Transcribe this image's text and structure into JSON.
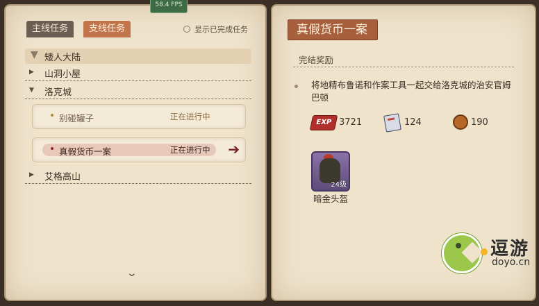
{
  "fps": "58.4 FPS",
  "left_page": {
    "tabs": {
      "main": "主线任务",
      "side": "支线任务"
    },
    "show_completed": "显示已完成任务",
    "groups": [
      {
        "label": "矮人大陆"
      },
      {
        "label": "山洞小屋"
      },
      {
        "label": "洛克城"
      },
      {
        "label": "艾格高山"
      }
    ],
    "quests": [
      {
        "name": "别碰罐子",
        "status": "正在进行中"
      },
      {
        "name": "真假货币一案",
        "status": "正在进行中"
      }
    ]
  },
  "right_page": {
    "title": "真假货币一案",
    "section_title": "完结奖励",
    "description": "将地精布鲁诺和作案工具一起交给洛克城的治安官姆巴顿",
    "rewards": {
      "exp_label": "EXP",
      "exp": "3721",
      "books": "124",
      "coins": "190"
    },
    "item": {
      "name": "暗金头盔",
      "level": "24级"
    }
  },
  "watermark": {
    "cn": "逗游",
    "en": "doyo.cn"
  },
  "colors": {
    "page": "#efe3cc",
    "accent": "#a8603c",
    "active_quest": "#8b2a25"
  }
}
